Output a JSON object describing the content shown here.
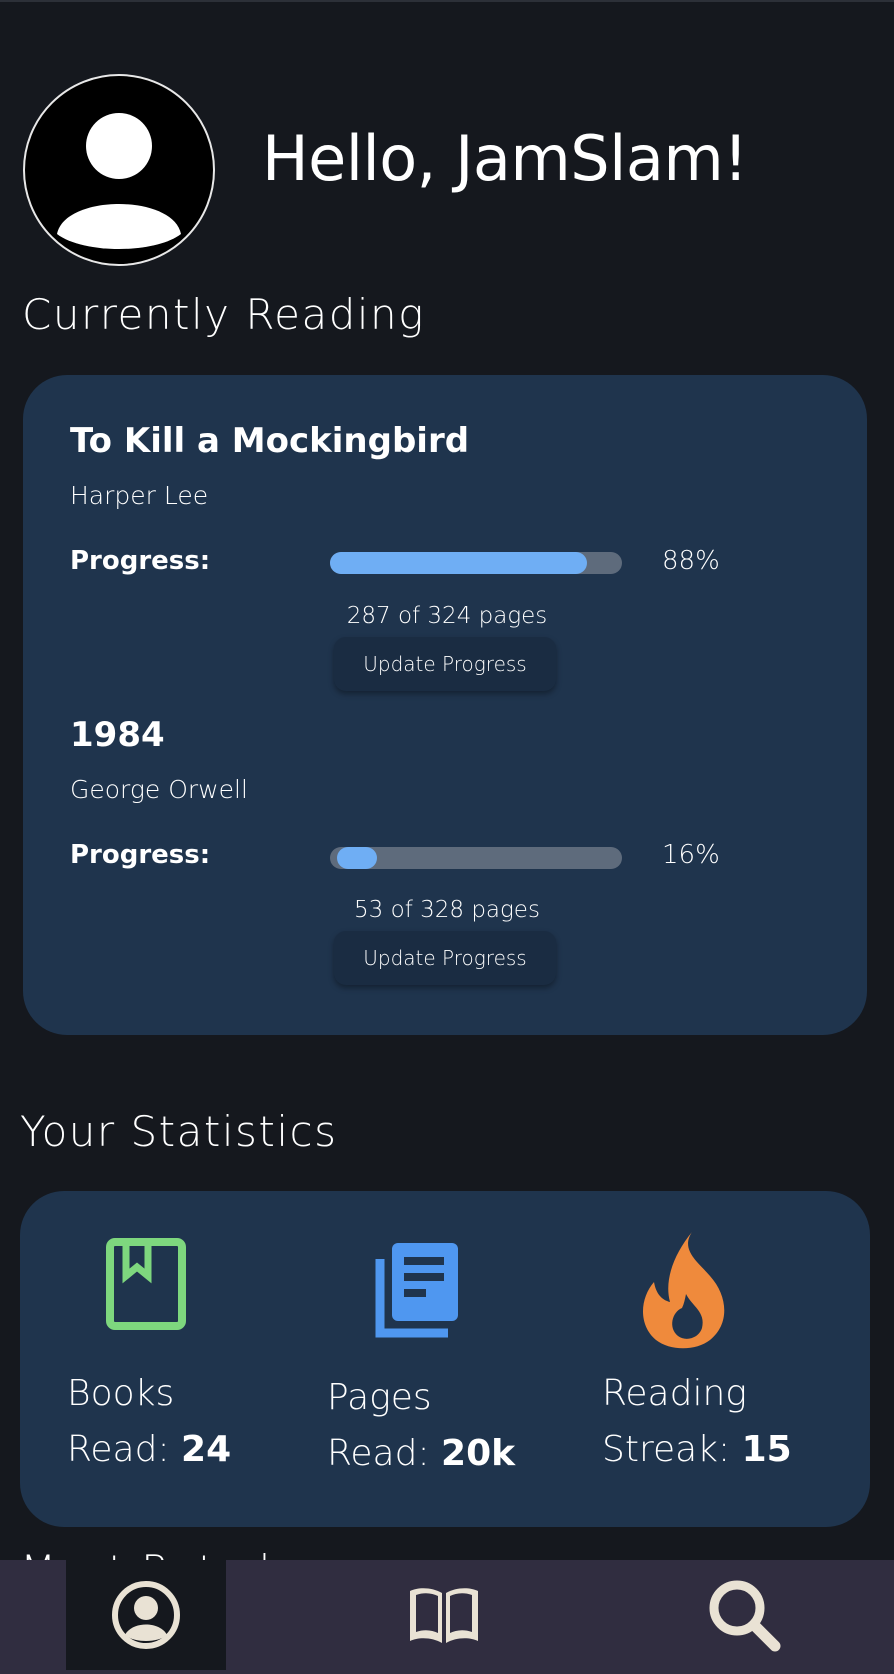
{
  "header": {
    "greeting": "Hello, JamSlam!",
    "avatar_icon": "user-avatar-icon"
  },
  "currently_reading": {
    "title": "Currently Reading",
    "books": [
      {
        "title": "To Kill a Mockingbird",
        "author": "Harper Lee",
        "progress_label": "Progress:",
        "progress_percent": 88,
        "percent_text": "88%",
        "pages_text": "287 of 324 pages",
        "button_label": "Update Progress"
      },
      {
        "title": "1984",
        "author": "George Orwell",
        "progress_label": "Progress:",
        "progress_percent": 16,
        "percent_text": "16%",
        "pages_text": "53 of 328 pages",
        "button_label": "Update Progress"
      }
    ]
  },
  "statistics": {
    "title": "Your Statistics",
    "items": [
      {
        "icon": "book-icon",
        "line1": "Books",
        "line2_label": "Read: ",
        "value": "24",
        "color": "#7ed77e"
      },
      {
        "icon": "pages-icon",
        "line1": "Pages",
        "line2_label": "Read: ",
        "value": "20k",
        "color": "#4f97f0"
      },
      {
        "icon": "flame-icon",
        "line1": "Reading",
        "line2_label": "Streak: ",
        "value": "15",
        "color": "#ef8a3c"
      }
    ]
  },
  "next_section_peek": "Most Rated...",
  "navbar": {
    "items": [
      {
        "icon": "profile-icon",
        "active": true
      },
      {
        "icon": "open-book-icon",
        "active": false
      },
      {
        "icon": "search-icon",
        "active": false
      }
    ],
    "icon_color": "#e9e2d4"
  }
}
